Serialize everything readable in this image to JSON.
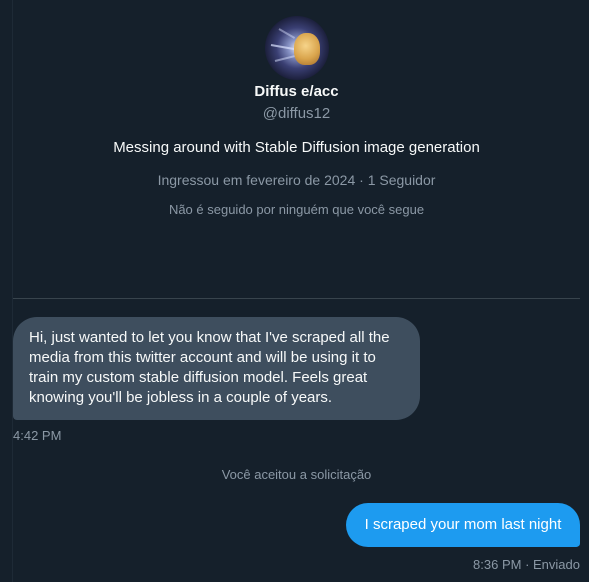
{
  "profile": {
    "display_name": "Diffus e/acc",
    "handle": "@diffus12",
    "bio": "Messing around with Stable Diffusion image generation",
    "joined_followers": "Ingressou em fevereiro de 2024 · 1 Seguidor",
    "not_followed_note": "Não é seguido por ninguém que você segue"
  },
  "conversation": {
    "incoming_message": {
      "text": "Hi, just wanted to let you know that I've scraped all the media from this twitter account and will be using it to train my custom stable diffusion model. Feels great knowing you'll be jobless in a couple of years.",
      "time": "4:42 PM"
    },
    "system_note": "Você aceitou a solicitação",
    "outgoing_message": {
      "text": "I scraped your mom last night",
      "meta": "8:36 PM · Enviado"
    }
  },
  "colors": {
    "background": "#15202b",
    "incoming_bubble": "#3e4e5e",
    "outgoing_bubble": "#1d9bf0",
    "secondary_text": "#8b98a5"
  }
}
